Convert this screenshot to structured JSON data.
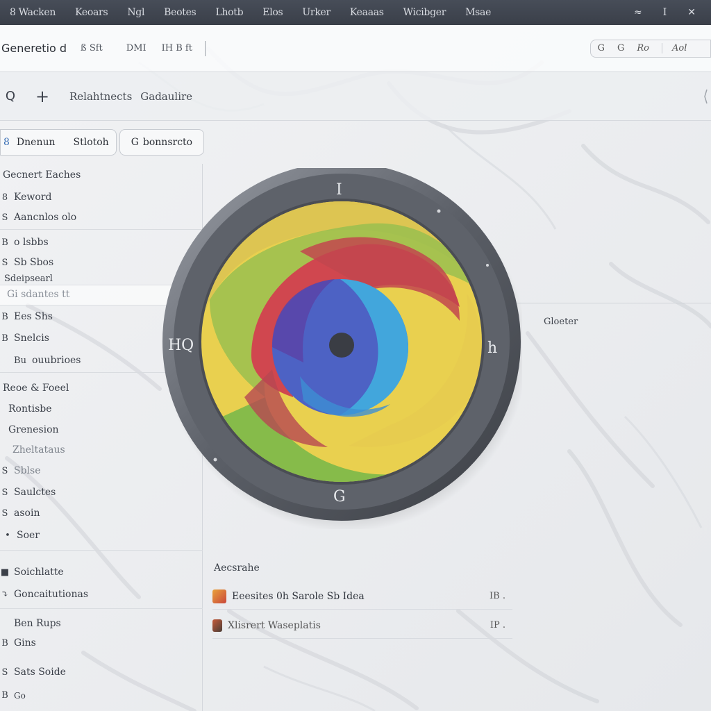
{
  "menubar": {
    "items": [
      "8 Wacken",
      "Keoars",
      "Ngl",
      "Beotes",
      "Lhotb",
      "Elos",
      "Urker",
      "Keaaas",
      "Wicibger",
      "Msae"
    ],
    "right": [
      "≈",
      "I",
      "✕"
    ]
  },
  "titlebar": {
    "app_title": "Generetio d",
    "tabs": [
      "ß  Sft",
      "DMI",
      "IH  B  ft"
    ],
    "controls": [
      "G",
      "G",
      "Ro"
    ],
    "action": "Aol"
  },
  "toolbar": {
    "search_icon": "Q",
    "add_icon": "+",
    "crumbs": [
      "Relahtnects",
      "Gadaulire"
    ]
  },
  "segment": {
    "icon": "8",
    "left": "Dnenun",
    "right": "Stlotoh",
    "single_icon": "G",
    "single_label": "bonnsrcto"
  },
  "sidebar": {
    "section_header": "Gecnert Eaches",
    "items": [
      {
        "icon": "8",
        "label": "Keword"
      },
      {
        "icon": "S",
        "label": "Aancnlos olo"
      },
      {
        "icon": "B",
        "label": "o lsbbs"
      },
      {
        "icon": "S",
        "label": "Sb Sbos"
      },
      {
        "icon": "",
        "label": "Sdeipsearl"
      },
      {
        "icon": "",
        "label": "Gi sdantes tt"
      },
      {
        "icon": "B",
        "label": "Ees Shs"
      },
      {
        "icon": "B",
        "label": "Snelcis"
      },
      {
        "icon": "Bu",
        "label": "ouubrioes"
      },
      {
        "icon": "",
        "label": "Reoe & Foeel"
      },
      {
        "icon": "",
        "label": "Rontisbe"
      },
      {
        "icon": "",
        "label": "Grenesion"
      },
      {
        "icon": "",
        "label": "Zheltataus"
      },
      {
        "icon": "S",
        "label": "Sblse"
      },
      {
        "icon": "S",
        "label": "Saulctes"
      },
      {
        "icon": "S",
        "label": "asoin"
      },
      {
        "icon": "•",
        "label": "Soer"
      },
      {
        "icon": "■",
        "label": "Soichlatte"
      },
      {
        "icon": "⤵",
        "label": "Goncaitutionas"
      },
      {
        "icon": "",
        "label": "Ben Rups"
      },
      {
        "icon": "B",
        "label": "Gins"
      },
      {
        "icon": "S",
        "label": "Sats Soide"
      },
      {
        "icon": "B",
        "label": "Go"
      }
    ]
  },
  "main": {
    "side_label": "Gloeter",
    "list_header": "Aecsrahe",
    "files": [
      {
        "name": "Eeesites 0h Sarole   Sb Idea",
        "meta": "IB ."
      },
      {
        "name": "Xlisrert Waseplatis",
        "meta": "IP ."
      }
    ]
  },
  "colors": {
    "menubar_bg": "#3f444e",
    "accent_yellow": "#e7cd4e",
    "accent_red": "#c0464f",
    "accent_green": "#86ba4b",
    "accent_blue": "#4f89d2",
    "accent_purple": "#6b4aa6",
    "ring": "#595d66"
  },
  "logo": {
    "dial_labels": [
      "I",
      "HQ",
      "h",
      "G"
    ]
  }
}
